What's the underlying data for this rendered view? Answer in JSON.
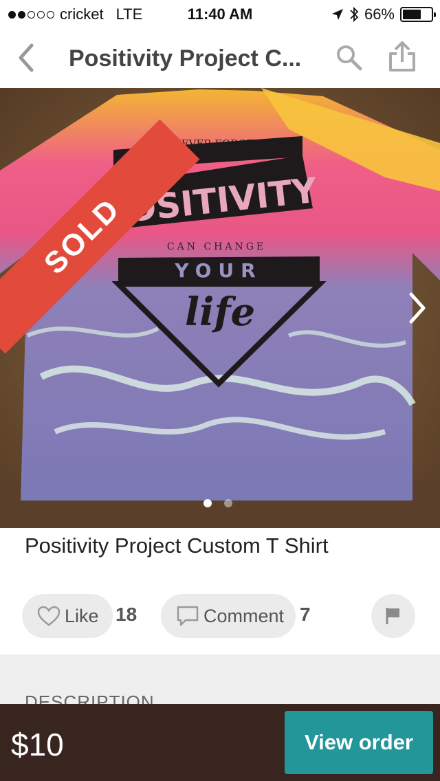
{
  "status_bar": {
    "carrier": "cricket",
    "network": "LTE",
    "time": "11:40 AM",
    "battery": "66%",
    "battery_level": 0.66,
    "signal_bars": 2
  },
  "nav": {
    "title": "Positivity Project C...",
    "icons": [
      "chevron-left-icon",
      "search-icon",
      "share-icon"
    ]
  },
  "photo": {
    "badge": "SOLD",
    "shirt_graphic": {
      "line1": "NEVER FORGET",
      "line2": "POSITIVITY",
      "line3": "CAN CHANGE",
      "line4": "YOUR",
      "line5": "life"
    },
    "page_count": 2,
    "active_page": 1
  },
  "item": {
    "title": "Positivity Project Custom T Shirt"
  },
  "actions": {
    "like_label": "Like",
    "like_count": "18",
    "comment_label": "Comment",
    "comment_count": "7"
  },
  "description": {
    "label": "DESCRIPTION"
  },
  "purchase": {
    "price": "$10",
    "button_label": "View order"
  },
  "colors": {
    "sold_ribbon": "#e24a3b",
    "button": "#23969a",
    "bottom_bar": "#382520"
  }
}
